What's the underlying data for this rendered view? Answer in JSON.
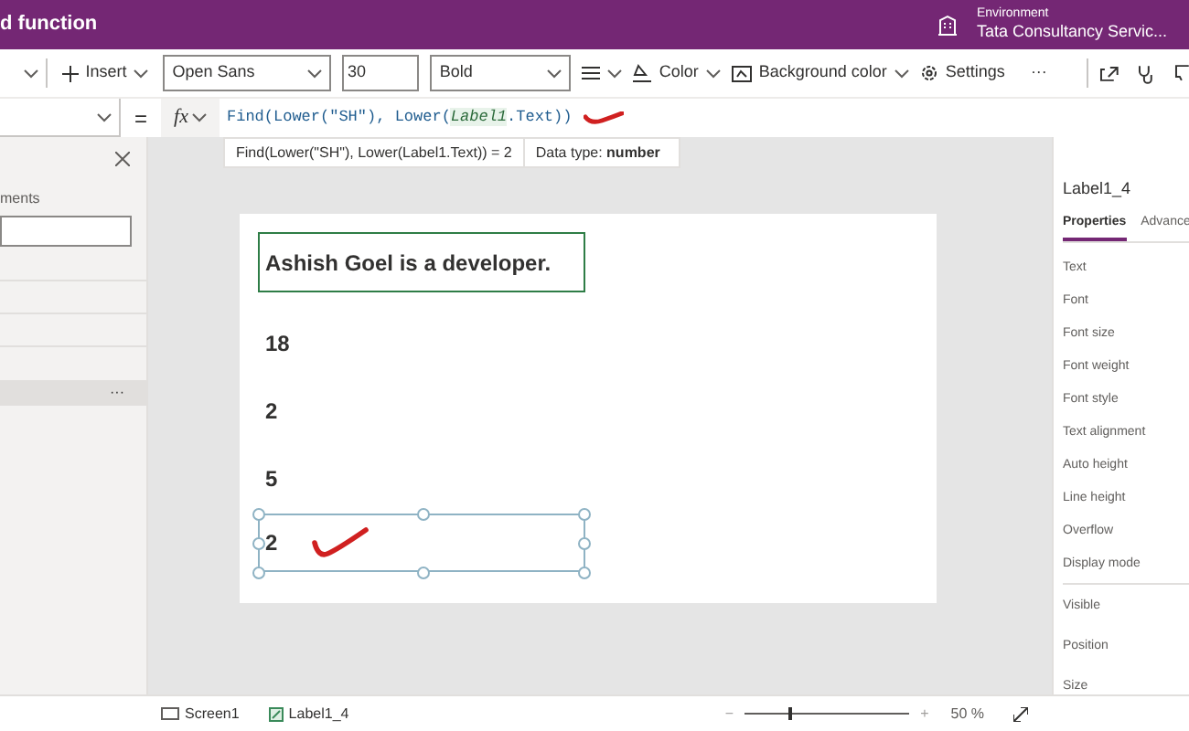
{
  "title_bar": {
    "title": "d function",
    "environment_label": "Environment",
    "environment_name": "Tata Consultancy Servic..."
  },
  "toolbar": {
    "insert": "Insert",
    "font": "Open Sans",
    "font_size": "30",
    "font_weight": "Bold",
    "color_button": "Color",
    "background_color": "Background color",
    "settings": "Settings",
    "more": "···"
  },
  "formula_bar": {
    "equals": "=",
    "fx": "fx",
    "formula_before": "Find(Lower(\"SH\"), Lower(",
    "formula_ref": "Label1",
    "formula_after": ".Text))",
    "result": "Find(Lower(\"SH\"), Lower(Label1.Text))  =  2",
    "data_type_label": "Data type:",
    "data_type": "number"
  },
  "tree_panel": {
    "search_label": "ments",
    "more": "···"
  },
  "canvas": {
    "labels": [
      {
        "text": "Ashish Goel is a developer.",
        "kind": "outlined",
        "selected": false
      },
      {
        "text": "18",
        "kind": "plain",
        "selected": false
      },
      {
        "text": "2",
        "kind": "plain",
        "selected": false
      },
      {
        "text": "5",
        "kind": "plain",
        "selected": false
      },
      {
        "text": "2",
        "kind": "plain",
        "selected": true
      }
    ]
  },
  "properties_panel": {
    "control_name": "Label1_4",
    "tabs": [
      {
        "label": "Properties",
        "selected": true
      },
      {
        "label": "Advance",
        "selected": false
      }
    ],
    "groups": [
      [
        "Text",
        "Font",
        "Font size",
        "Font weight",
        "Font style",
        "Text alignment",
        "Auto height",
        "Line height",
        "Overflow",
        "Display mode"
      ],
      [
        "Visible",
        "Position",
        "Size"
      ]
    ]
  },
  "status_bar": {
    "screen": "Screen1",
    "control": "Label1_4",
    "zoom_out": "−",
    "zoom": {
      "level": 0.27
    },
    "zoom_in": "+",
    "zoom_reading": "50 %"
  }
}
